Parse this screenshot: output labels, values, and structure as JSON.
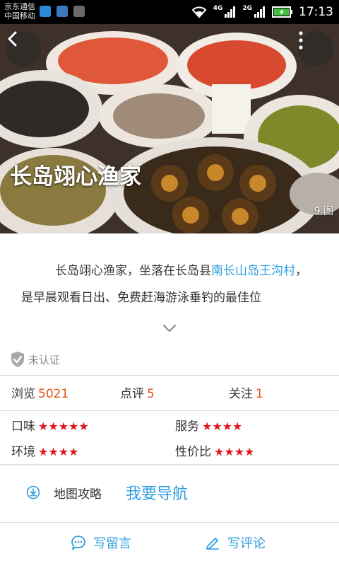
{
  "status_bar": {
    "carrier_1": "京东通信",
    "carrier_2": "中国移动",
    "net_4g": "4G",
    "net_2g": "2G",
    "time": "17:13"
  },
  "hero": {
    "title": "长岛翊心渔家",
    "photo_count": "9 图"
  },
  "description": {
    "part1": "长岛翊心渔家，坐落在长岛县",
    "link": "南长山岛王沟村",
    "part2": "，是早晨观看日出、免费赶海游泳垂钓的最佳位"
  },
  "verification": {
    "label": "未认证"
  },
  "stats": {
    "views_label": "浏览",
    "views_value": "5021",
    "reviews_label": "点评",
    "reviews_value": "5",
    "follow_label": "关注",
    "follow_value": "1"
  },
  "ratings": [
    {
      "label": "口味",
      "stars": "★★★★★"
    },
    {
      "label": "服务",
      "stars": "★★★★"
    },
    {
      "label": "环境",
      "stars": "★★★★"
    },
    {
      "label": "性价比",
      "stars": "★★★★"
    }
  ],
  "map": {
    "guide_label": "地图攻略",
    "navigate_label": "我要导航"
  },
  "bottom_bar": {
    "message_label": "写留言",
    "review_label": "写评论"
  },
  "colors": {
    "accent": "#2f9de0",
    "value_orange": "#e8501a",
    "star_red": "#e0161e"
  }
}
